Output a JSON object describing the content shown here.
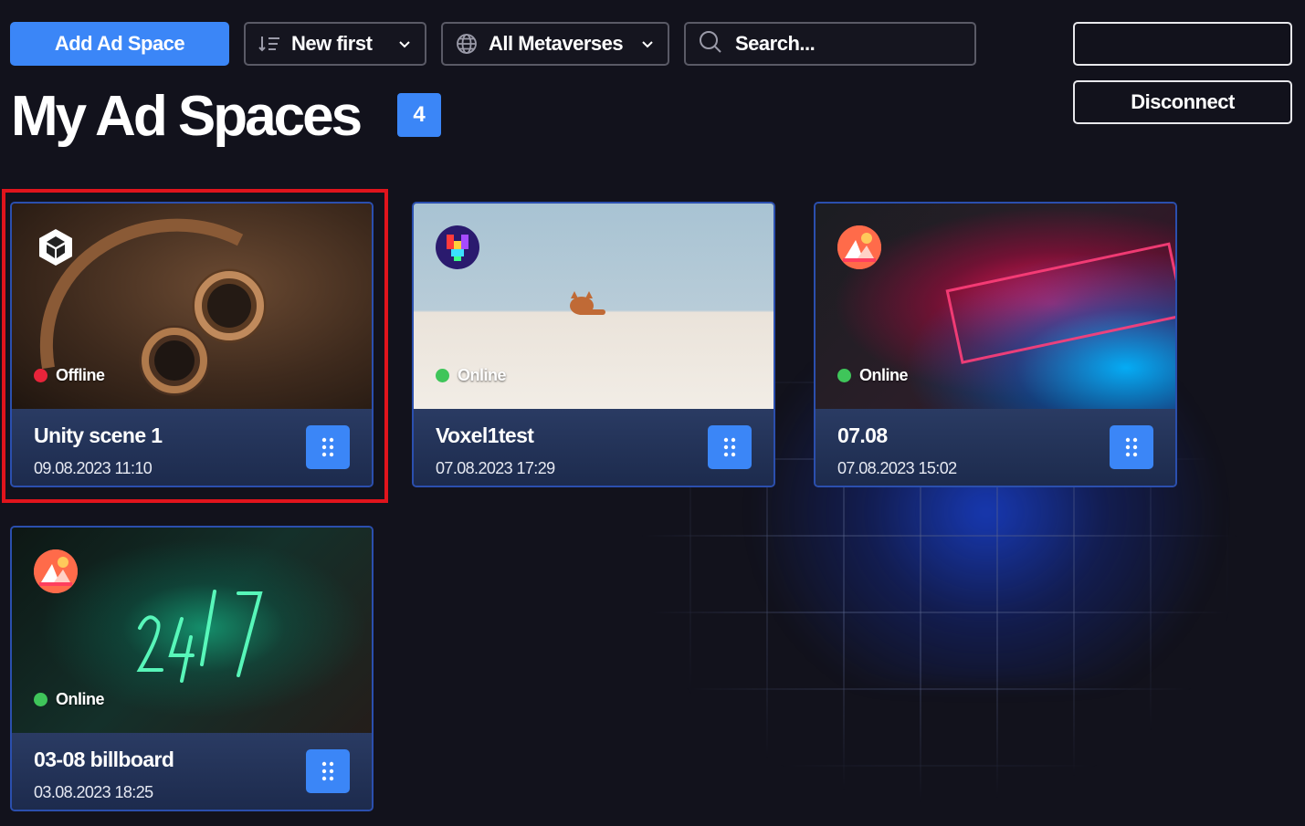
{
  "toolbar": {
    "add_label": "Add Ad Space",
    "sort_label": "New first",
    "metaverse_label": "All Metaverses",
    "search_placeholder": "Search...",
    "disconnect_label": "Disconnect"
  },
  "header": {
    "title": "My Ad Spaces",
    "count": "4"
  },
  "cards": [
    {
      "name": "Unity scene 1",
      "date": "09.08.2023 11:10",
      "status": "Offline",
      "status_color": "#e8243a",
      "platform": "unity-logo-icon",
      "selected": true
    },
    {
      "name": "Voxel1test",
      "date": "07.08.2023 17:29",
      "status": "Online",
      "status_color": "#3fc55a",
      "platform": "voxels-logo-icon",
      "selected": false
    },
    {
      "name": "07.08",
      "date": "07.08.2023 15:02",
      "status": "Online",
      "status_color": "#3fc55a",
      "platform": "decentraland-logo-icon",
      "selected": false
    },
    {
      "name": "03-08 billboard",
      "date": "03.08.2023 18:25",
      "status": "Online",
      "status_color": "#3fc55a",
      "platform": "decentraland-logo-icon",
      "selected": false
    }
  ],
  "colors": {
    "accent": "#3b86f7",
    "selection": "#e0141c",
    "background": "#12121c"
  }
}
